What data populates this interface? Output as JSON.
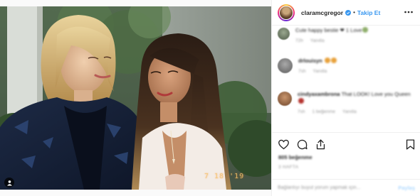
{
  "header": {
    "username": "claramcgregor",
    "separator": "•",
    "follow_label": "Takip Et"
  },
  "media": {
    "date_stamp": "7 18 '19"
  },
  "comments": [
    {
      "username": "",
      "text": "Cute happy bestie ❤ 1 Love",
      "meta_time": "72h",
      "meta_reply": "Yanıtla"
    },
    {
      "username": "drlouisyn",
      "text": "",
      "meta_time": "7sh",
      "meta_reply": "Yanıtla"
    },
    {
      "username": "cindyaxambrona",
      "text": "That LOOK! Love you Queen",
      "meta_time": "7sh",
      "meta_likes": "1 beğenme",
      "meta_reply": "Yanıtla"
    }
  ],
  "footer": {
    "likes": "805 beğenme",
    "age": "3 HAFTA",
    "comment_placeholder": "Bağlantıyı buyut yorum yapmak için...",
    "post_label": "Paylaş"
  },
  "colors": {
    "accent": "#3897f0",
    "border": "#efefef",
    "muted": "#999999"
  }
}
